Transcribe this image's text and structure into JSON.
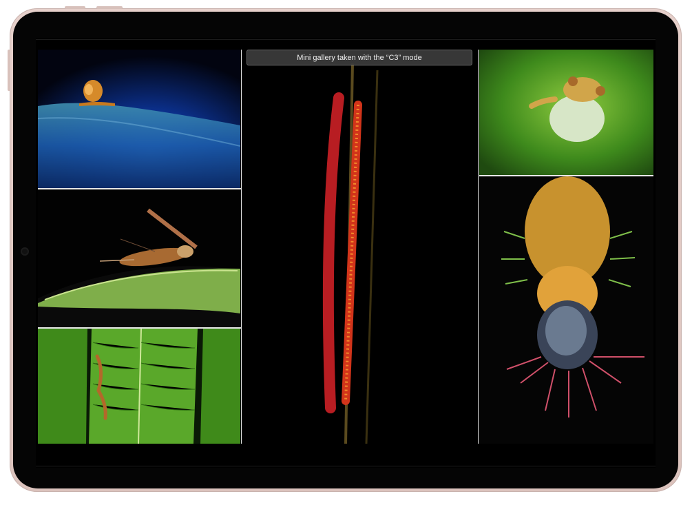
{
  "device": {
    "type": "tablet",
    "frame_color": "#e3cbc5"
  },
  "gallery": {
    "caption": "Mini gallery taken with the “C3” mode",
    "photos": [
      {
        "subject": "snail on blue leaf",
        "icon": "snail-photo"
      },
      {
        "subject": "cockroach on green leaf",
        "icon": "cockroach-photo"
      },
      {
        "subject": "lizard on fern",
        "icon": "lizard-fern-photo"
      },
      {
        "subject": "red millipede on stem",
        "icon": "millipede-photo"
      },
      {
        "subject": "frog with vocal sac",
        "icon": "frog-photo"
      },
      {
        "subject": "spiky caterpillar",
        "icon": "caterpillar-photo"
      }
    ]
  }
}
